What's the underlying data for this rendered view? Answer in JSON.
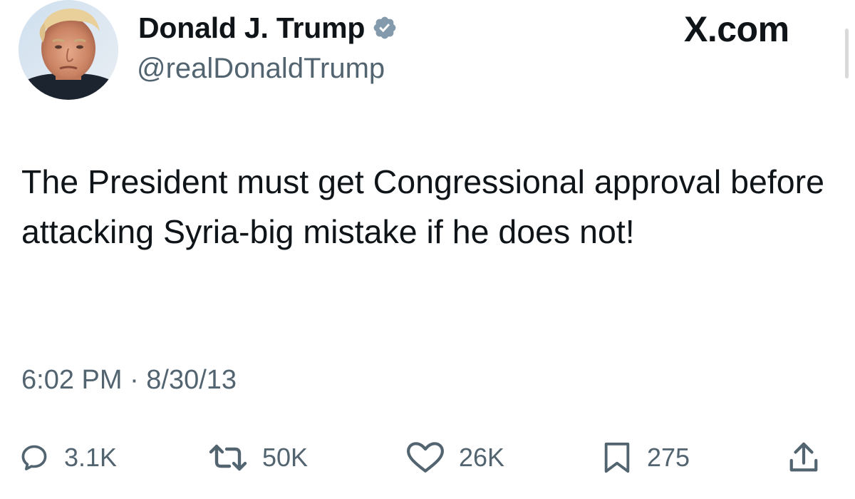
{
  "header": {
    "display_name": "Donald J. Trump",
    "handle": "@realDonaldTrump",
    "site_label": "X.com"
  },
  "icons": {
    "avatar": "profile-photo",
    "verified": "verified-badge-icon",
    "reply": "reply-icon",
    "retweet": "retweet-icon",
    "like": "like-heart-icon",
    "bookmark": "bookmark-icon",
    "share": "share-icon"
  },
  "tweet": {
    "text": "The President must get Congressional approval before attacking Syria-big mistake if he does not!",
    "timestamp": "6:02 PM · 8/30/13"
  },
  "actions": {
    "replies": "3.1K",
    "retweets": "50K",
    "likes": "26K",
    "bookmarks": "275"
  },
  "colors": {
    "text": "#0f1419",
    "secondary": "#536471",
    "verified_badge": "#829aab"
  }
}
